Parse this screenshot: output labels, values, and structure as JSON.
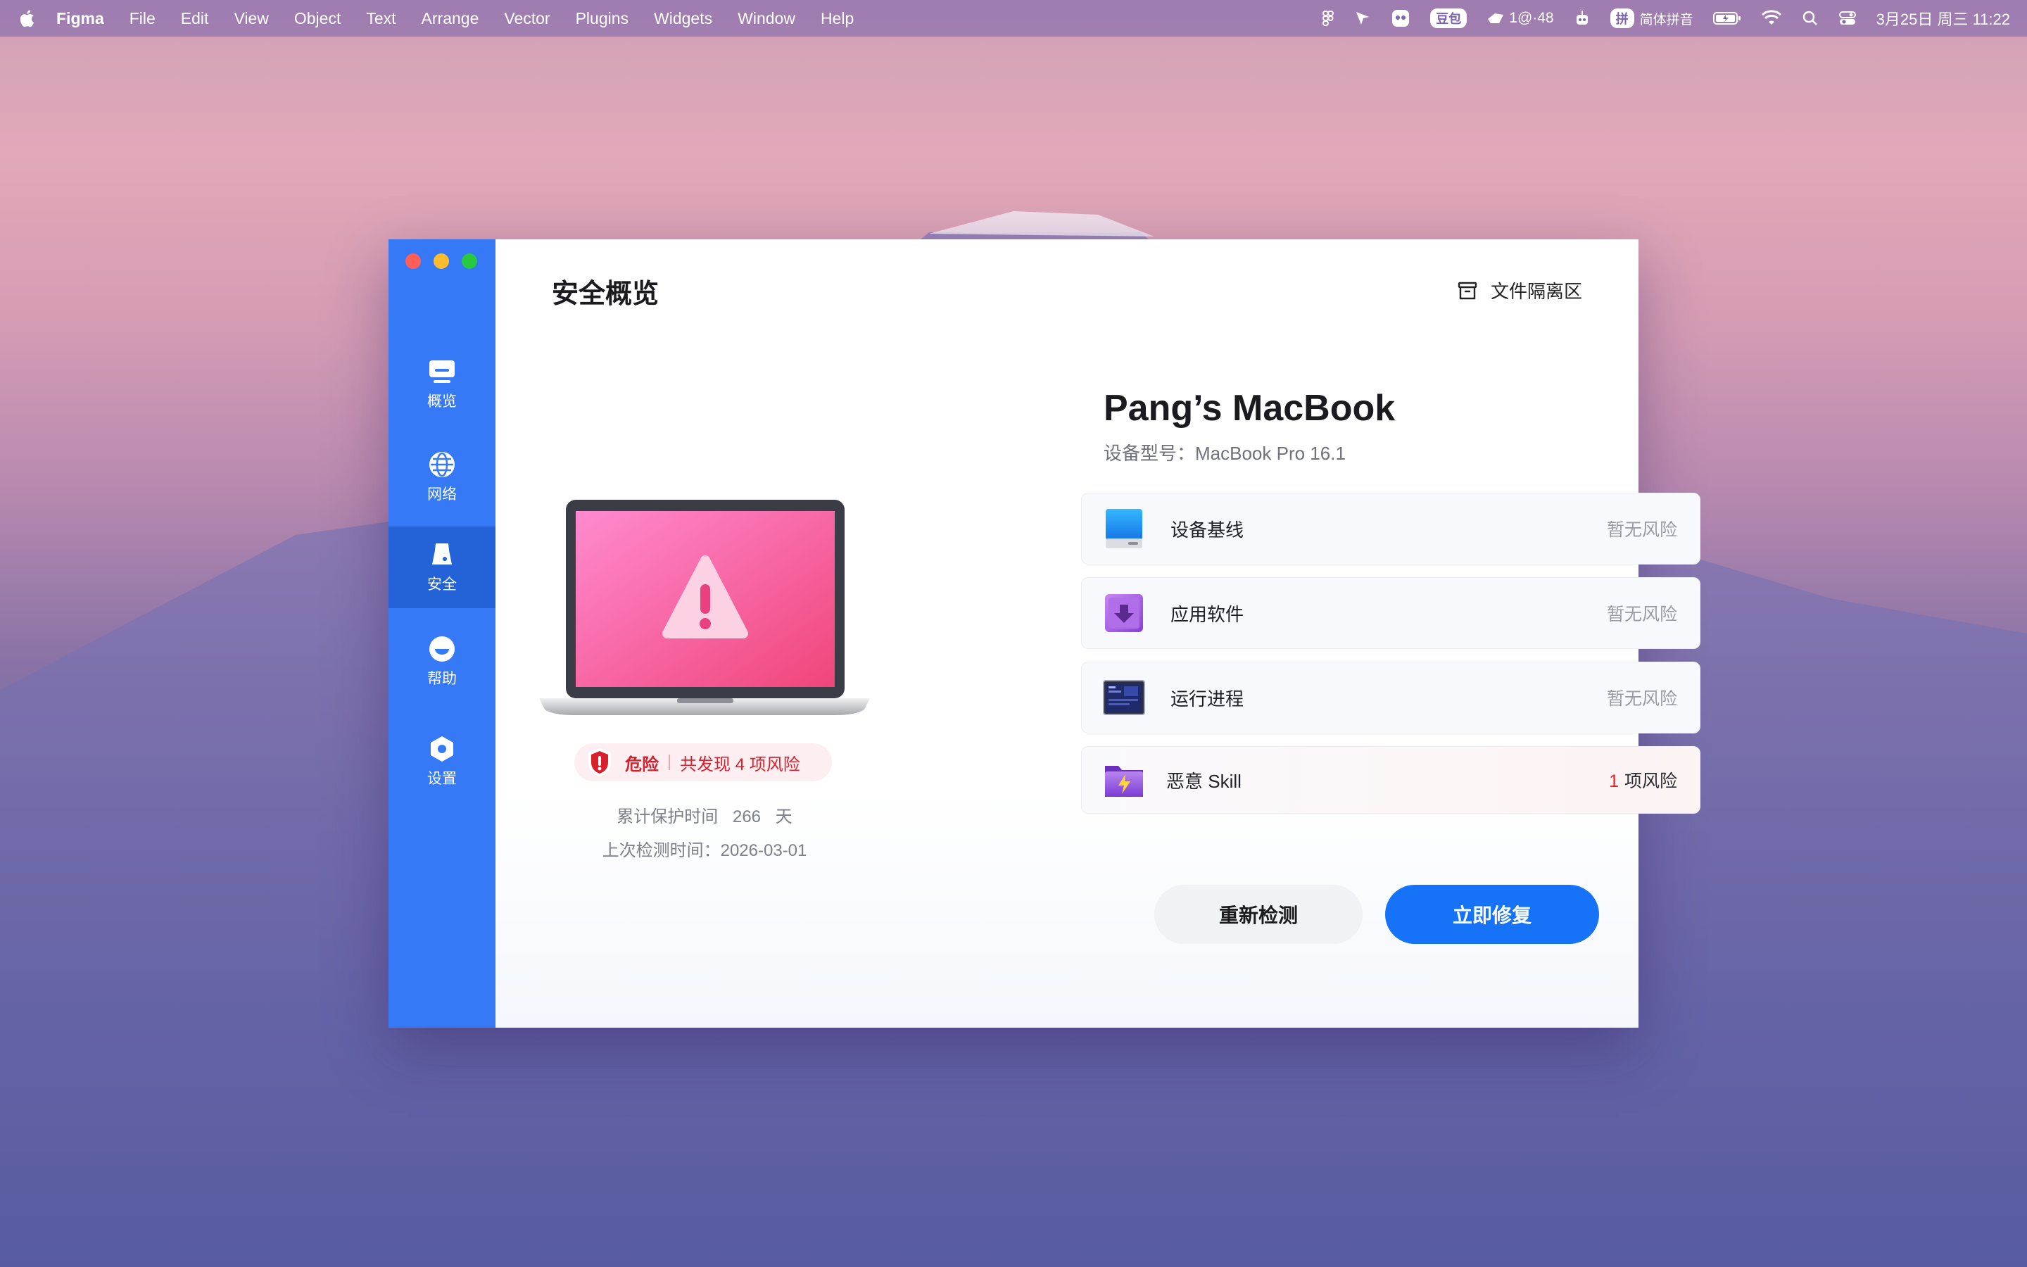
{
  "menubar": {
    "app_name": "Figma",
    "menus": [
      "File",
      "Edit",
      "View",
      "Object",
      "Text",
      "Arrange",
      "Vector",
      "Plugins",
      "Widgets",
      "Window",
      "Help"
    ],
    "tray": {
      "doubao_label": "豆包",
      "counter_label": "1@·48",
      "ime_badge": "拼",
      "ime_label": "简体拼音",
      "datetime": "3月25日 周三  11:22"
    }
  },
  "window": {
    "sidebar": {
      "items": [
        {
          "label": "概览",
          "icon": "monitor-icon"
        },
        {
          "label": "网络",
          "icon": "globe-icon"
        },
        {
          "label": "安全",
          "icon": "security-icon",
          "active": true
        },
        {
          "label": "帮助",
          "icon": "help-icon"
        },
        {
          "label": "设置",
          "icon": "settings-icon"
        }
      ]
    },
    "header": {
      "title": "安全概览",
      "quarantine_label": "文件隔离区"
    },
    "device": {
      "name": "Pang’s MacBook",
      "model_label": "设备型号：",
      "model_value": "MacBook Pro 16.1"
    },
    "status": {
      "level": "危险",
      "found_prefix": "共发现 ",
      "found_count": "4",
      "found_suffix": " 项风险",
      "protect_label": "累计保护时间",
      "protect_value": "266",
      "protect_unit": "天",
      "last_scan_label": "上次检测时间：",
      "last_scan_value": "2026-03-01"
    },
    "checks": [
      {
        "label": "设备基线",
        "status": "暂无风险",
        "icon": "disk-icon"
      },
      {
        "label": "应用软件",
        "status": "暂无风险",
        "icon": "app-download-icon"
      },
      {
        "label": "运行进程",
        "status": "暂无风险",
        "icon": "process-screen-icon"
      },
      {
        "label": "恶意 Skill",
        "risk_count": "1",
        "risk_unit": "项风险",
        "icon": "skill-folder-icon"
      }
    ],
    "buttons": {
      "rescan": "重新检测",
      "fix": "立即修复"
    },
    "colors": {
      "sidebar": "#3579f6",
      "primary": "#1673f7",
      "danger": "#d8212d"
    }
  }
}
